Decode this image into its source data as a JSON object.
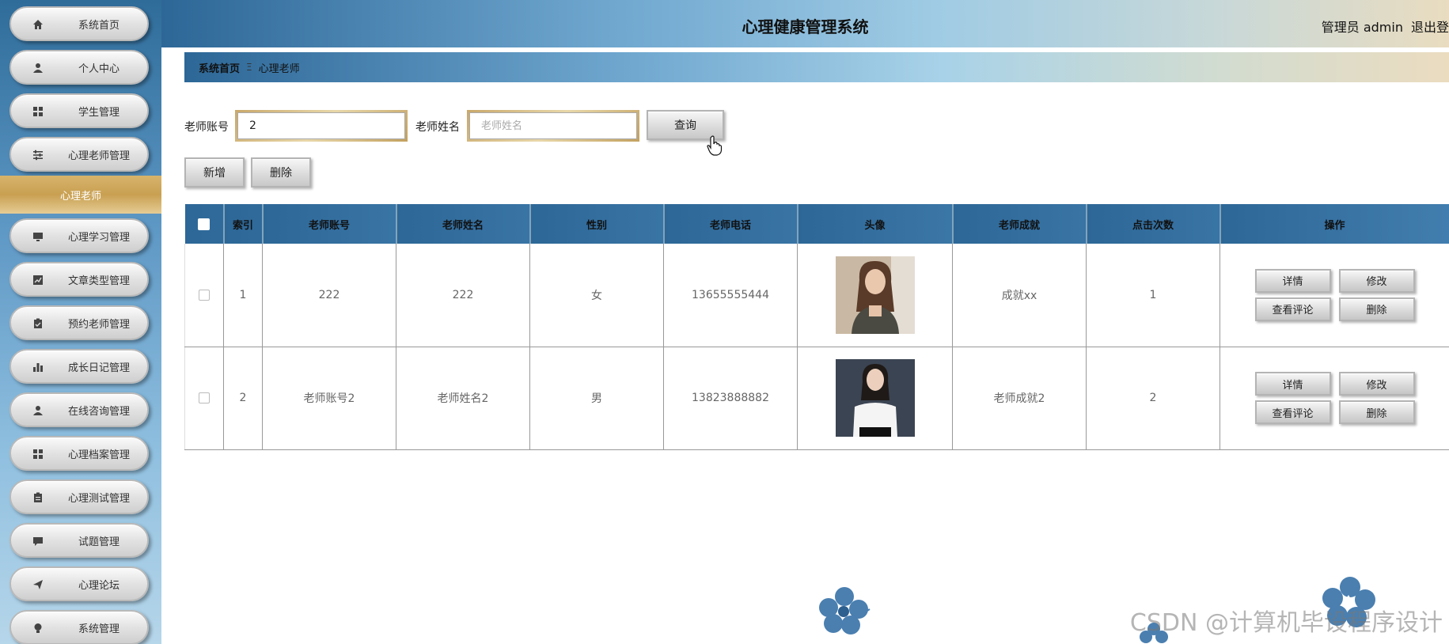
{
  "header": {
    "title": "心理健康管理系统",
    "user_role": "管理员 admin",
    "logout": "退出登"
  },
  "sidebar": {
    "items": [
      {
        "label": "系统首页",
        "icon": "home-icon"
      },
      {
        "label": "个人中心",
        "icon": "user-icon"
      },
      {
        "label": "学生管理",
        "icon": "grid-icon"
      },
      {
        "label": "心理老师管理",
        "icon": "sliders-icon"
      },
      {
        "label": "心理学习管理",
        "icon": "monitor-icon"
      },
      {
        "label": "文章类型管理",
        "icon": "chart-icon"
      },
      {
        "label": "预约老师管理",
        "icon": "clipboard-check-icon"
      },
      {
        "label": "成长日记管理",
        "icon": "bar-chart-icon"
      },
      {
        "label": "在线咨询管理",
        "icon": "user-icon"
      },
      {
        "label": "心理档案管理",
        "icon": "grid-icon"
      },
      {
        "label": "心理测试管理",
        "icon": "clipboard-icon"
      },
      {
        "label": "试题管理",
        "icon": "chat-icon"
      },
      {
        "label": "心理论坛",
        "icon": "send-icon"
      },
      {
        "label": "系统管理",
        "icon": "bulb-icon"
      }
    ],
    "active_sub": "心理老师"
  },
  "breadcrumb": {
    "home": "系统首页",
    "separator": "Ξ",
    "current": "心理老师"
  },
  "search": {
    "account_label": "老师账号",
    "account_value": "2",
    "name_label": "老师姓名",
    "name_placeholder": "老师姓名",
    "query_button": "查询"
  },
  "actions": {
    "add": "新增",
    "delete": "删除"
  },
  "table": {
    "columns": [
      "索引",
      "老师账号",
      "老师姓名",
      "性别",
      "老师电话",
      "头像",
      "老师成就",
      "点击次数",
      "操作"
    ],
    "rows": [
      {
        "index": "1",
        "account": "222",
        "name": "222",
        "gender": "女",
        "phone": "13655555444",
        "achievement": "成就xx",
        "clicks": "1"
      },
      {
        "index": "2",
        "account": "老师账号2",
        "name": "老师姓名2",
        "gender": "男",
        "phone": "13823888882",
        "achievement": "老师成就2",
        "clicks": "2"
      }
    ],
    "row_actions": {
      "detail": "详情",
      "edit": "修改",
      "comments": "查看评论",
      "delete": "删除"
    }
  },
  "watermark": "CSDN @计算机毕设程序设计",
  "colors": {
    "accent_blue": "#2d6797",
    "gold": "#c9a052",
    "flower": "#4a7fb0"
  }
}
